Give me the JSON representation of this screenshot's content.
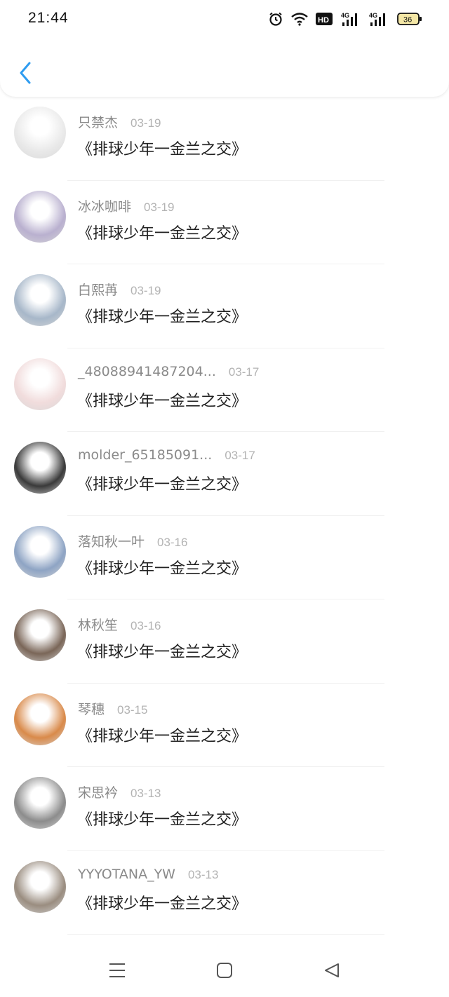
{
  "status_bar": {
    "time": "21:44",
    "hd_label": "HD",
    "signal1_label": "4G",
    "signal2_label": "4G",
    "battery": "36",
    "icons": [
      "alarm-icon",
      "wifi-icon",
      "hd-icon",
      "signal-4g-icon",
      "signal-4g-icon",
      "battery-icon"
    ]
  },
  "header": {
    "back_icon": "chevron-left-icon",
    "accent_color": "#2e9cf0"
  },
  "list": [
    {
      "name": "只禁杰",
      "date": "03-19",
      "title": "《排球少年一金兰之交》",
      "avatar_color": "#e9e9e9"
    },
    {
      "name": "冰冰咖啡",
      "date": "03-19",
      "title": "《排球少年一金兰之交》",
      "avatar_color": "#b9b0cf"
    },
    {
      "name": "白熙苒",
      "date": "03-19",
      "title": "《排球少年一金兰之交》",
      "avatar_color": "#a7b7c9"
    },
    {
      "name": "_48088941487204...",
      "date": "03-17",
      "title": "《排球少年一金兰之交》",
      "avatar_color": "#f1dcdc"
    },
    {
      "name": "molder_65185091...",
      "date": "03-17",
      "title": "《排球少年一金兰之交》",
      "avatar_color": "#3a3a3a"
    },
    {
      "name": "落知秋一叶",
      "date": "03-16",
      "title": "《排球少年一金兰之交》",
      "avatar_color": "#8ea4c4"
    },
    {
      "name": "林秋笙",
      "date": "03-16",
      "title": "《排球少年一金兰之交》",
      "avatar_color": "#7a6658"
    },
    {
      "name": "琴穗",
      "date": "03-15",
      "title": "《排球少年一金兰之交》",
      "avatar_color": "#d98a4a"
    },
    {
      "name": "宋思衿",
      "date": "03-13",
      "title": "《排球少年一金兰之交》",
      "avatar_color": "#8c8c8c"
    },
    {
      "name": "YYYOTANA_YW",
      "date": "03-13",
      "title": "《排球少年一金兰之交》",
      "avatar_color": "#9a8d80"
    }
  ],
  "nav_bar": {
    "icons": [
      "menu-icon",
      "home-icon",
      "back-triangle-icon"
    ]
  }
}
